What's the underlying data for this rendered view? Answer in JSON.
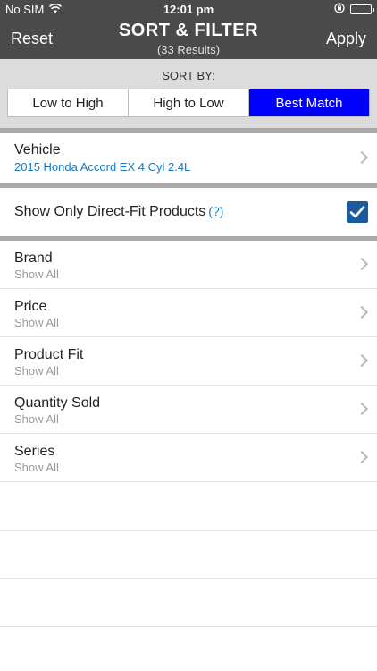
{
  "status_bar": {
    "carrier": "No SIM",
    "time": "12:01 pm"
  },
  "nav": {
    "reset_label": "Reset",
    "title": "SORT & FILTER",
    "subtitle": "(33 Results)",
    "apply_label": "Apply"
  },
  "sort": {
    "label": "SORT BY:",
    "options": [
      {
        "label": "Low to High"
      },
      {
        "label": "High to Low"
      },
      {
        "label": "Best Match"
      }
    ],
    "selected": "Best Match"
  },
  "vehicle": {
    "title": "Vehicle",
    "value": "2015 Honda Accord EX 4 Cyl 2.4L"
  },
  "direct_fit": {
    "label": "Show Only Direct-Fit Products",
    "help": "(?)",
    "checked": true
  },
  "filters": [
    {
      "title": "Brand",
      "value": "Show All"
    },
    {
      "title": "Price",
      "value": "Show All"
    },
    {
      "title": "Product Fit",
      "value": "Show All"
    },
    {
      "title": "Quantity Sold",
      "value": "Show All"
    },
    {
      "title": "Series",
      "value": "Show All"
    }
  ],
  "colors": {
    "bar": "#4a4a4a",
    "accent": "#0000ff",
    "link": "#1a78c2",
    "checkbox": "#1a5a9e"
  },
  "icons": [
    "wifi-icon",
    "lock-rotation-icon",
    "battery-icon",
    "chevron-right-icon",
    "checkmark-icon"
  ]
}
